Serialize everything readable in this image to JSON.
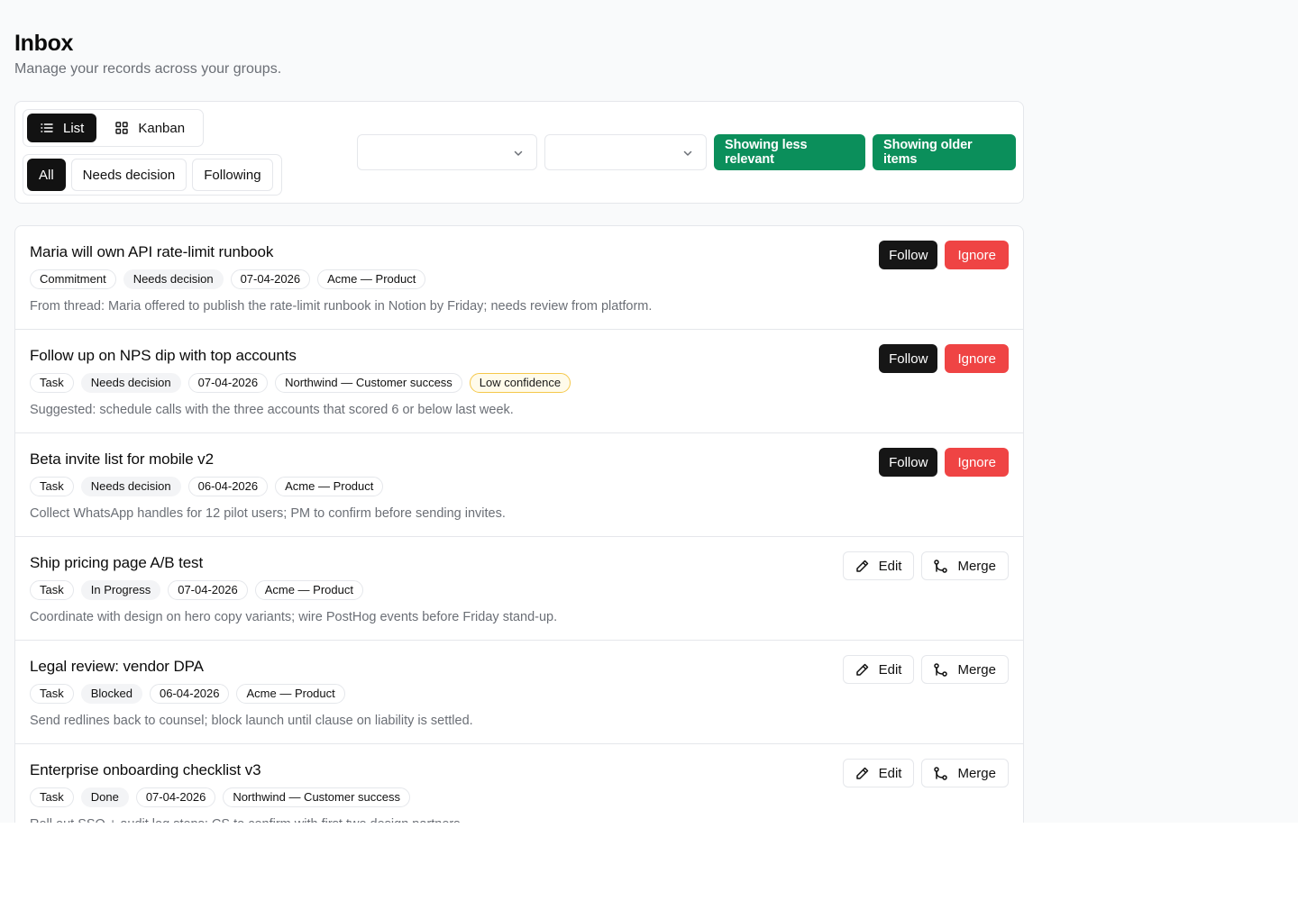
{
  "page": {
    "title": "Inbox",
    "subtitle": "Manage your records across your groups."
  },
  "toolbar": {
    "view_toggle": [
      {
        "label": "List",
        "icon": "list-icon",
        "active": true
      },
      {
        "label": "Kanban",
        "icon": "grid-icon",
        "active": false
      }
    ],
    "filters": [
      {
        "label": "All",
        "active": true
      },
      {
        "label": "Needs decision",
        "active": false
      },
      {
        "label": "Following",
        "active": false
      }
    ],
    "select_1": {
      "value": ""
    },
    "select_2": {
      "value": ""
    },
    "relevance_button": "Showing less relevant",
    "age_button": "Showing older items"
  },
  "colors": {
    "accent_green": "#0b8f5b",
    "danger_red": "#ef4444",
    "primary_dark": "#161616",
    "warning_border": "#f5c84b"
  },
  "records": [
    {
      "title": "Maria will own API rate-limit runbook",
      "type": "Commitment",
      "status": "Needs decision",
      "date": "07-04-2026",
      "group": "Acme — Product",
      "description": "From thread: Maria offered to publish the rate-limit runbook in Notion by Friday; needs review from platform.",
      "actions": {
        "follow": "Follow",
        "ignore": "Ignore"
      }
    },
    {
      "title": "Follow up on NPS dip with top accounts",
      "type": "Task",
      "status": "Needs decision",
      "date": "07-04-2026",
      "group": "Northwind — Customer success",
      "flag": "Low confidence",
      "description": "Suggested: schedule calls with the three accounts that scored 6 or below last week.",
      "actions": {
        "follow": "Follow",
        "ignore": "Ignore"
      }
    },
    {
      "title": "Beta invite list for mobile v2",
      "type": "Task",
      "status": "Needs decision",
      "date": "06-04-2026",
      "group": "Acme — Product",
      "description": "Collect WhatsApp handles for 12 pilot users; PM to confirm before sending invites.",
      "actions": {
        "follow": "Follow",
        "ignore": "Ignore"
      }
    },
    {
      "title": "Ship pricing page A/B test",
      "type": "Task",
      "status": "In Progress",
      "date": "07-04-2026",
      "group": "Acme — Product",
      "description": "Coordinate with design on hero copy variants; wire PostHog events before Friday stand-up.",
      "actions": {
        "edit": "Edit",
        "merge": "Merge"
      }
    },
    {
      "title": "Legal review: vendor DPA",
      "type": "Task",
      "status": "Blocked",
      "date": "06-04-2026",
      "group": "Acme — Product",
      "description": "Send redlines back to counsel; block launch until clause on liability is settled.",
      "actions": {
        "edit": "Edit",
        "merge": "Merge"
      }
    },
    {
      "title": "Enterprise onboarding checklist v3",
      "type": "Task",
      "status": "Done",
      "date": "07-04-2026",
      "group": "Northwind — Customer success",
      "description": "Roll out SSO + audit log steps; CS to confirm with first two design partners.",
      "actions": {
        "edit": "Edit",
        "merge": "Merge"
      }
    }
  ]
}
